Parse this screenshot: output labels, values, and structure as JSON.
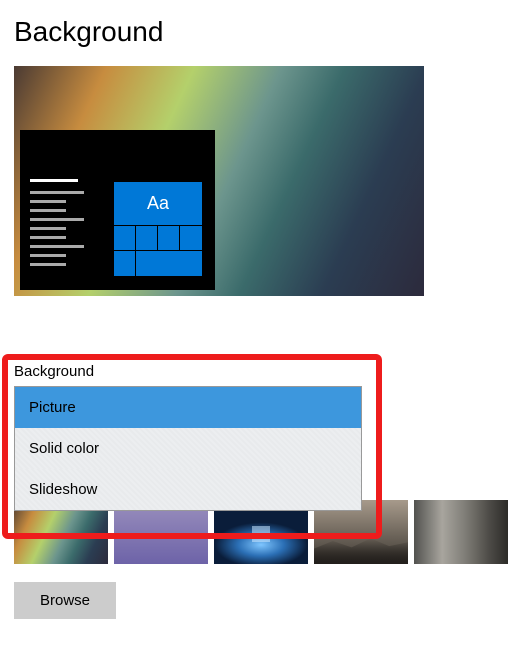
{
  "page": {
    "title": "Background"
  },
  "preview": {
    "tile_label": "Aa"
  },
  "dropdown": {
    "label": "Background",
    "items": {
      "0": "Picture",
      "1": "Solid color",
      "2": "Slideshow"
    },
    "selected_index": 0
  },
  "browse": {
    "label": "Browse"
  }
}
